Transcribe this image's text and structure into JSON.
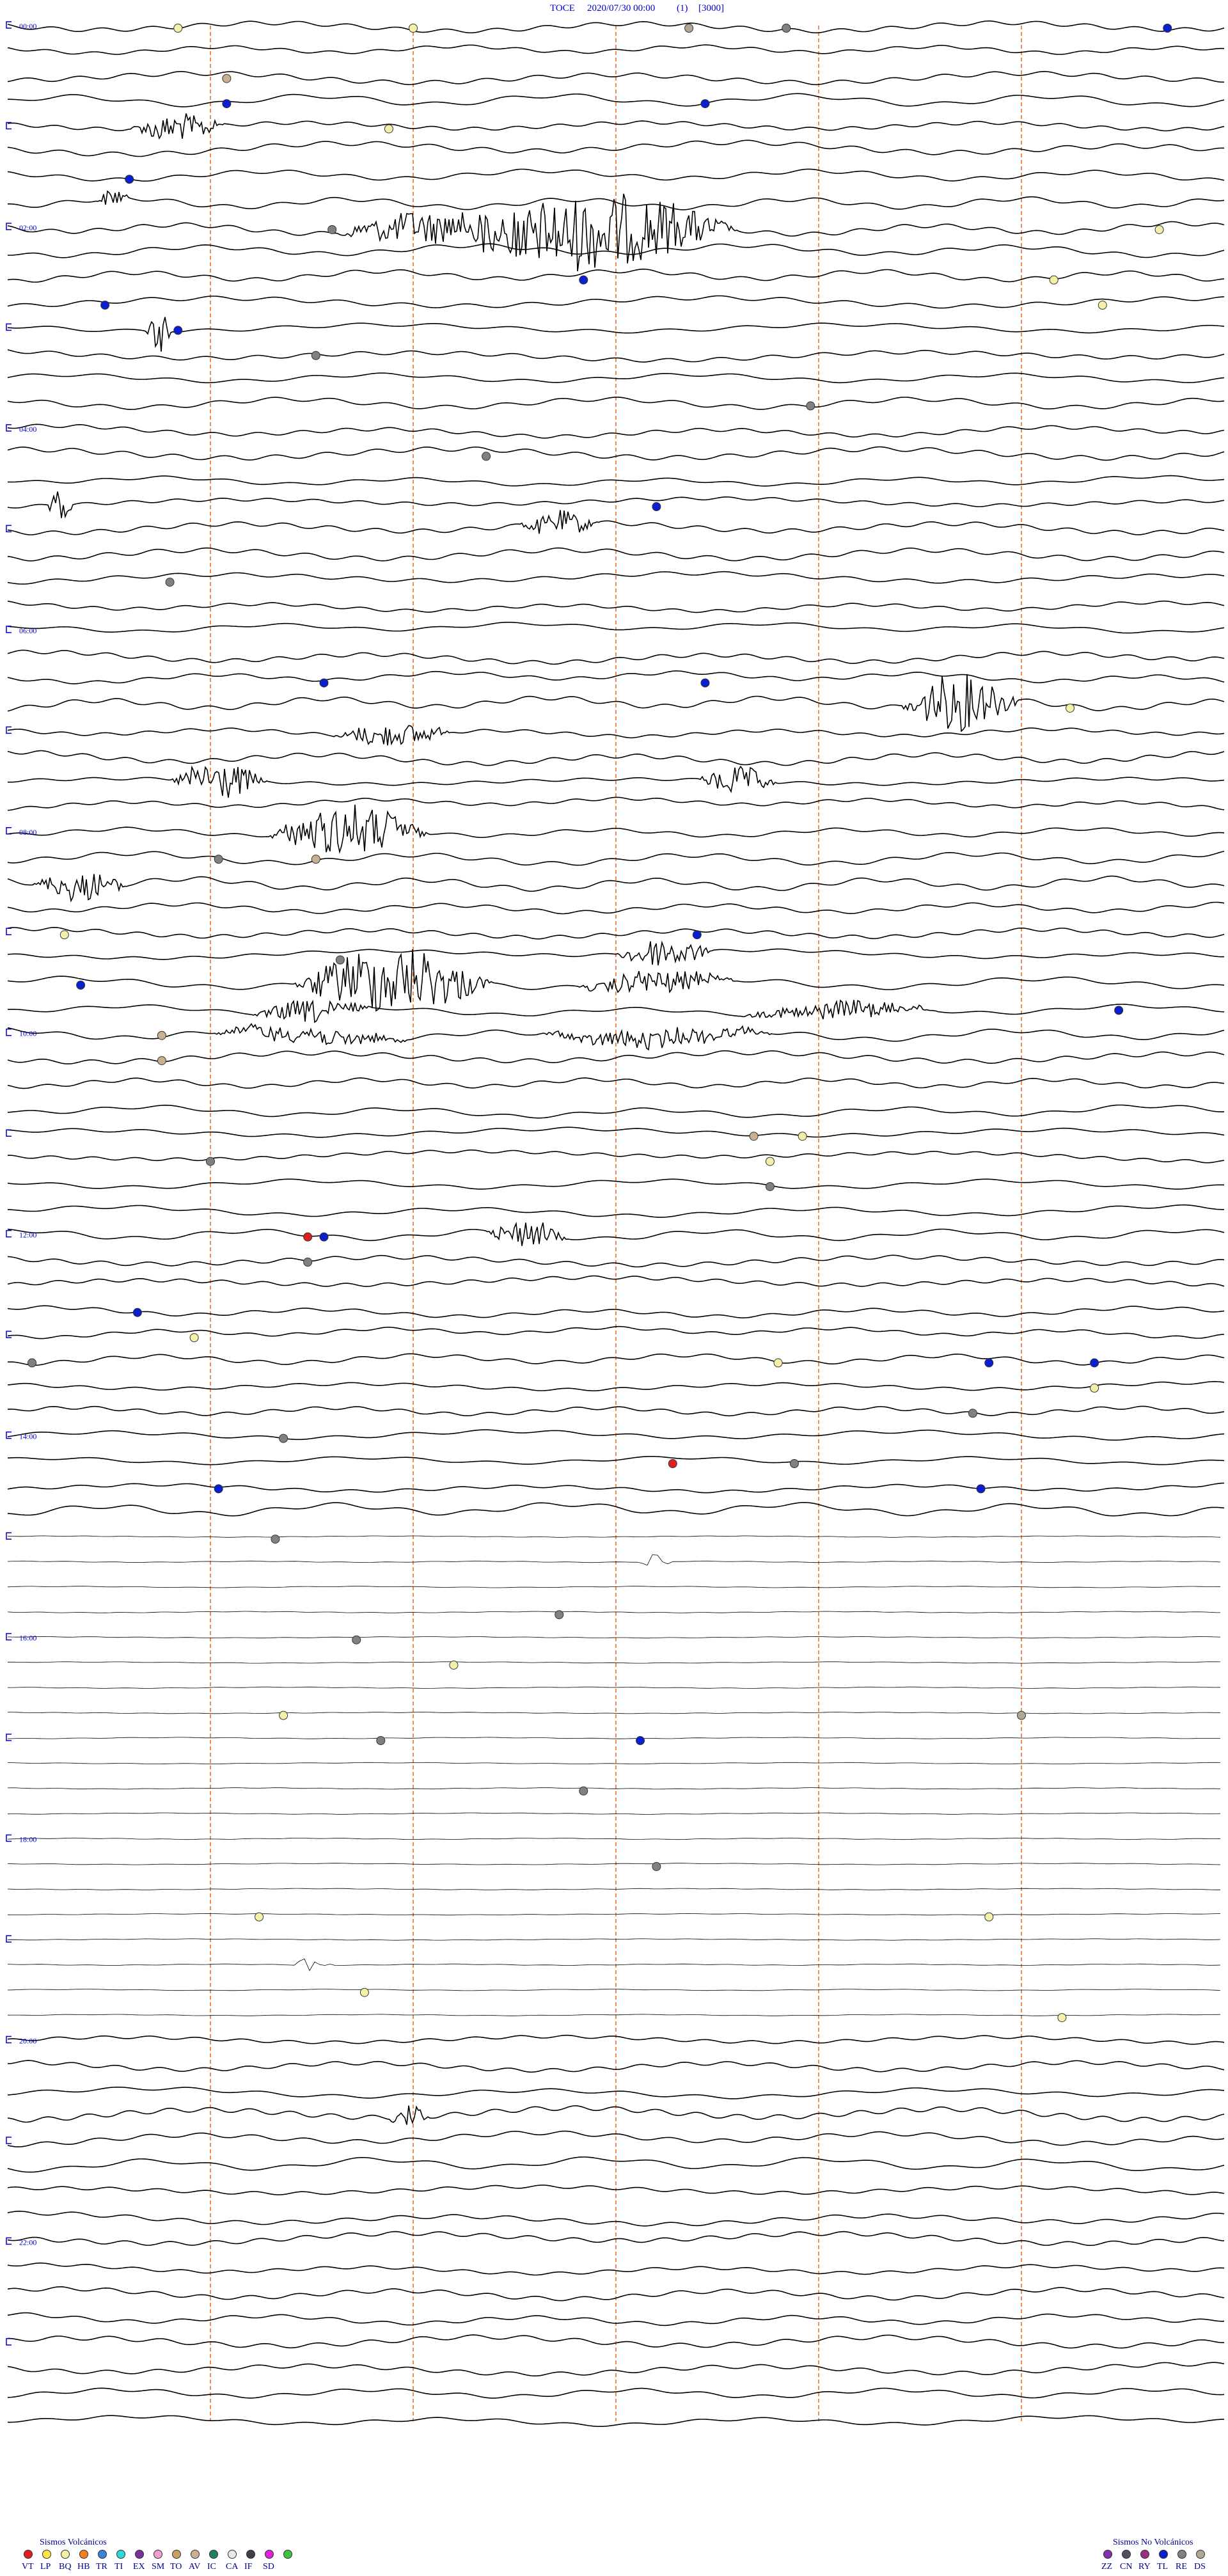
{
  "header": {
    "station": "TOCE",
    "datetime": "2020/07/30 00:00",
    "channel": "(1)",
    "scale": "[3000]"
  },
  "colors": {
    "trace": "#000000",
    "minute_marker": "#f08c50",
    "hour_label": "#0000cc",
    "legend_text": "#00008b"
  },
  "chart_data": {
    "type": "helicorder",
    "rows": 96,
    "minutes_per_row": 15,
    "hour_labels": [
      "00:00",
      "02:00",
      "04:00",
      "06:00",
      "08:00",
      "10:00",
      "12:00",
      "14:00",
      "16:00",
      "18:00",
      "20:00",
      "22:00"
    ],
    "quiet_rows": [
      60,
      79
    ],
    "bursts": [
      {
        "row": 4,
        "minute": 1.5,
        "amp": 22,
        "dur": 1.2
      },
      {
        "row": 7,
        "minute": 1.1,
        "amp": 15,
        "dur": 0.4
      },
      {
        "row": 8,
        "minute": 5.5,
        "amp": 60,
        "dur": 3.5
      },
      {
        "row": 8,
        "minute": 4.0,
        "amp": 25,
        "dur": 2.5
      },
      {
        "row": 12,
        "minute": 1.7,
        "amp": 32,
        "dur": 0.4
      },
      {
        "row": 19,
        "minute": 0.5,
        "amp": 42,
        "dur": 0.3
      },
      {
        "row": 20,
        "minute": 6.3,
        "amp": 18,
        "dur": 1.0
      },
      {
        "row": 27,
        "minute": 11.0,
        "amp": 45,
        "dur": 1.5
      },
      {
        "row": 28,
        "minute": 4.0,
        "amp": 18,
        "dur": 1.5
      },
      {
        "row": 30,
        "minute": 2.0,
        "amp": 30,
        "dur": 1.2
      },
      {
        "row": 30,
        "minute": 8.5,
        "amp": 22,
        "dur": 1.0
      },
      {
        "row": 32,
        "minute": 3.2,
        "amp": 40,
        "dur": 2.0
      },
      {
        "row": 34,
        "minute": 0.3,
        "amp": 22,
        "dur": 1.2
      },
      {
        "row": 37,
        "minute": 7.5,
        "amp": 24,
        "dur": 1.2
      },
      {
        "row": 38,
        "minute": 3.5,
        "amp": 52,
        "dur": 2.5
      },
      {
        "row": 38,
        "minute": 7.0,
        "amp": 18,
        "dur": 2.0
      },
      {
        "row": 39,
        "minute": 3.0,
        "amp": 18,
        "dur": 1.5
      },
      {
        "row": 39,
        "minute": 9.0,
        "amp": 14,
        "dur": 2.5
      },
      {
        "row": 40,
        "minute": 2.5,
        "amp": 14,
        "dur": 2.5
      },
      {
        "row": 40,
        "minute": 6.5,
        "amp": 14,
        "dur": 3.0
      },
      {
        "row": 48,
        "minute": 5.9,
        "amp": 22,
        "dur": 1.0
      },
      {
        "row": 61,
        "minute": 7.8,
        "amp": 12,
        "dur": 0.4
      },
      {
        "row": 77,
        "minute": 3.5,
        "amp": 12,
        "dur": 0.5
      },
      {
        "row": 83,
        "minute": 4.7,
        "amp": 16,
        "dur": 0.5
      }
    ],
    "events": [
      {
        "row": 0,
        "minute": 2.1,
        "type": "BQ"
      },
      {
        "row": 0,
        "minute": 5.0,
        "type": "BQ"
      },
      {
        "row": 0,
        "minute": 8.4,
        "type": "DS"
      },
      {
        "row": 0,
        "minute": 9.6,
        "type": "RE"
      },
      {
        "row": 0,
        "minute": 14.3,
        "type": "TL"
      },
      {
        "row": 2,
        "minute": 2.7,
        "type": "AV"
      },
      {
        "row": 3,
        "minute": 2.7,
        "type": "TL"
      },
      {
        "row": 3,
        "minute": 8.6,
        "type": "TL"
      },
      {
        "row": 4,
        "minute": 4.7,
        "type": "BQ"
      },
      {
        "row": 6,
        "minute": 1.5,
        "type": "TL"
      },
      {
        "row": 8,
        "minute": 4.0,
        "type": "RE"
      },
      {
        "row": 8,
        "minute": 14.2,
        "type": "BQ"
      },
      {
        "row": 10,
        "minute": 7.1,
        "type": "TL"
      },
      {
        "row": 10,
        "minute": 12.9,
        "type": "BQ"
      },
      {
        "row": 11,
        "minute": 1.2,
        "type": "TL"
      },
      {
        "row": 11,
        "minute": 13.5,
        "type": "BQ"
      },
      {
        "row": 12,
        "minute": 2.1,
        "type": "TL"
      },
      {
        "row": 13,
        "minute": 3.8,
        "type": "RE"
      },
      {
        "row": 15,
        "minute": 9.9,
        "type": "RE"
      },
      {
        "row": 17,
        "minute": 5.9,
        "type": "RE"
      },
      {
        "row": 19,
        "minute": 8.0,
        "type": "TL"
      },
      {
        "row": 22,
        "minute": 2.0,
        "type": "RE"
      },
      {
        "row": 26,
        "minute": 3.9,
        "type": "TL"
      },
      {
        "row": 26,
        "minute": 8.6,
        "type": "TL"
      },
      {
        "row": 27,
        "minute": 13.1,
        "type": "BQ"
      },
      {
        "row": 33,
        "minute": 2.6,
        "type": "RE"
      },
      {
        "row": 33,
        "minute": 3.8,
        "type": "AV"
      },
      {
        "row": 36,
        "minute": 0.7,
        "type": "BQ"
      },
      {
        "row": 36,
        "minute": 8.5,
        "type": "TL"
      },
      {
        "row": 37,
        "minute": 4.1,
        "type": "RE"
      },
      {
        "row": 38,
        "minute": 0.9,
        "type": "TL"
      },
      {
        "row": 39,
        "minute": 13.7,
        "type": "TL"
      },
      {
        "row": 40,
        "minute": 1.9,
        "type": "AV"
      },
      {
        "row": 41,
        "minute": 1.9,
        "type": "AV"
      },
      {
        "row": 44,
        "minute": 9.8,
        "type": "BQ"
      },
      {
        "row": 44,
        "minute": 9.2,
        "type": "AV"
      },
      {
        "row": 45,
        "minute": 9.4,
        "type": "BQ"
      },
      {
        "row": 45,
        "minute": 2.5,
        "type": "RE"
      },
      {
        "row": 46,
        "minute": 9.4,
        "type": "RE"
      },
      {
        "row": 48,
        "minute": 3.7,
        "type": "VT"
      },
      {
        "row": 48,
        "minute": 3.9,
        "type": "TL"
      },
      {
        "row": 49,
        "minute": 3.7,
        "type": "RE"
      },
      {
        "row": 51,
        "minute": 1.6,
        "type": "TL"
      },
      {
        "row": 52,
        "minute": 2.3,
        "type": "BQ"
      },
      {
        "row": 53,
        "minute": 0.3,
        "type": "RE"
      },
      {
        "row": 53,
        "minute": 9.5,
        "type": "BQ"
      },
      {
        "row": 53,
        "minute": 12.1,
        "type": "TL"
      },
      {
        "row": 53,
        "minute": 13.4,
        "type": "TL"
      },
      {
        "row": 54,
        "minute": 13.4,
        "type": "BQ"
      },
      {
        "row": 55,
        "minute": 11.9,
        "type": "RE"
      },
      {
        "row": 56,
        "minute": 3.4,
        "type": "RE"
      },
      {
        "row": 57,
        "minute": 9.7,
        "type": "RE"
      },
      {
        "row": 57,
        "minute": 8.2,
        "type": "VT"
      },
      {
        "row": 58,
        "minute": 2.6,
        "type": "TL"
      },
      {
        "row": 58,
        "minute": 12.0,
        "type": "TL"
      },
      {
        "row": 60,
        "minute": 3.3,
        "type": "RE"
      },
      {
        "row": 63,
        "minute": 6.8,
        "type": "RE"
      },
      {
        "row": 64,
        "minute": 4.3,
        "type": "RE"
      },
      {
        "row": 65,
        "minute": 5.5,
        "type": "BQ"
      },
      {
        "row": 67,
        "minute": 3.4,
        "type": "BQ"
      },
      {
        "row": 67,
        "minute": 12.5,
        "type": "DS"
      },
      {
        "row": 68,
        "minute": 7.8,
        "type": "TL"
      },
      {
        "row": 68,
        "minute": 4.6,
        "type": "RE"
      },
      {
        "row": 70,
        "minute": 7.1,
        "type": "RE"
      },
      {
        "row": 73,
        "minute": 8.0,
        "type": "RE"
      },
      {
        "row": 75,
        "minute": 3.1,
        "type": "BQ"
      },
      {
        "row": 75,
        "minute": 12.1,
        "type": "BQ"
      },
      {
        "row": 78,
        "minute": 4.4,
        "type": "BQ"
      },
      {
        "row": 79,
        "minute": 13.0,
        "type": "BQ"
      }
    ]
  },
  "legend_volcanic": {
    "title": "Sismos Volcánicos",
    "items": [
      {
        "code": "VT",
        "color": "#e02020"
      },
      {
        "code": "LP",
        "color": "#ffe640"
      },
      {
        "code": "BQ",
        "color": "#f4f0a8"
      },
      {
        "code": "HB",
        "color": "#f08020"
      },
      {
        "code": "TR",
        "color": "#3c82e0"
      },
      {
        "code": "TI",
        "color": "#30d8d8"
      },
      {
        "code": "EX",
        "color": "#7a2f9a"
      },
      {
        "code": "SM",
        "color": "#f0a0d0"
      },
      {
        "code": "TO",
        "color": "#c8a060"
      },
      {
        "code": "AV",
        "color": "#c8b090"
      },
      {
        "code": "IC",
        "color": "#208060"
      },
      {
        "code": "CA",
        "color": "#e8e8e8"
      },
      {
        "code": "IF",
        "color": "#404048"
      },
      {
        "code": "SD",
        "color": "#e020e0"
      },
      {
        "code": "",
        "color": "#40c040"
      }
    ]
  },
  "legend_nonvolcanic": {
    "title": "Sismos No Volcánicos",
    "items": [
      {
        "code": "ZZ",
        "color": "#8030b0"
      },
      {
        "code": "CN",
        "color": "#505060"
      },
      {
        "code": "RY",
        "color": "#9a3080"
      },
      {
        "code": "TL",
        "color": "#0a20d0"
      },
      {
        "code": "RE",
        "color": "#808080"
      },
      {
        "code": "DS",
        "color": "#b0a890"
      }
    ]
  }
}
